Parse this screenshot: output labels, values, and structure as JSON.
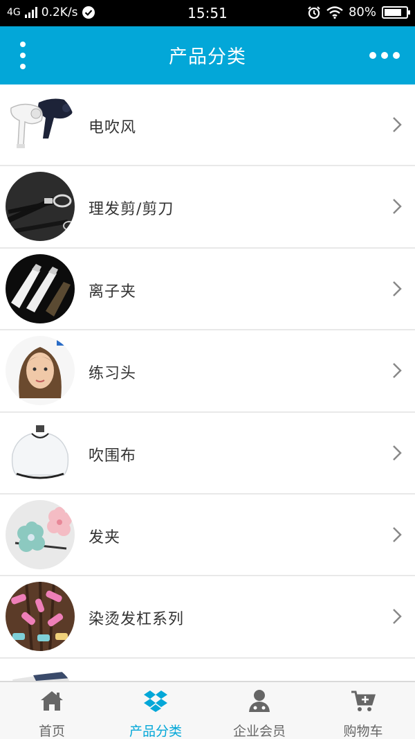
{
  "status_bar": {
    "network": "4G",
    "speed": "0.2K/s",
    "time": "15:51",
    "battery": "80%",
    "battery_level": 0.8
  },
  "header": {
    "title": "产品分类",
    "color": "#03a7d8"
  },
  "categories": [
    {
      "label": "电吹风",
      "thumb_icon": "hair-dryer-image"
    },
    {
      "label": "理发剪/剪刀",
      "thumb_icon": "scissors-image"
    },
    {
      "label": "离子夹",
      "thumb_icon": "hair-straightener-image"
    },
    {
      "label": "练习头",
      "thumb_icon": "mannequin-head-image"
    },
    {
      "label": "吹围布",
      "thumb_icon": "haircut-cape-image"
    },
    {
      "label": "发夹",
      "thumb_icon": "hair-clip-image"
    },
    {
      "label": "染烫发杠系列",
      "thumb_icon": "hair-rollers-image"
    }
  ],
  "tabs": [
    {
      "label": "首页",
      "icon": "home-icon",
      "active": false
    },
    {
      "label": "产品分类",
      "icon": "dropbox-icon",
      "active": true
    },
    {
      "label": "企业会员",
      "icon": "member-icon",
      "active": false
    },
    {
      "label": "购物车",
      "icon": "cart-icon",
      "active": false
    }
  ],
  "colors": {
    "accent": "#03a7d8",
    "inactive_tab": "#666666"
  }
}
